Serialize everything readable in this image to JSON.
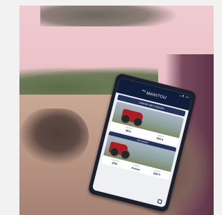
{
  "app": {
    "brand_prefix": "my",
    "brand_name": "MANITOU",
    "status_bar": "▲ 🔋 4:04"
  },
  "sections": [
    {
      "label": "Collection with a reliquaire"
    }
  ],
  "cards": [
    {
      "stats": [
        {
          "label": "Machine",
          "value": "36%"
        },
        {
          "label": "Heures",
          "value": "250 h"
        }
      ]
    },
    {
      "caption": "Mon matériel",
      "stats": [
        {
          "label": "Carburant",
          "value": "25%"
        },
        {
          "label": "Position",
          "value": "Aucun"
        },
        {
          "label": "Heures",
          "value": "258 h"
        }
      ]
    }
  ],
  "colors": {
    "header": "#0f1d3a",
    "accent": "#22345c",
    "machine_red": "#b4171d"
  }
}
